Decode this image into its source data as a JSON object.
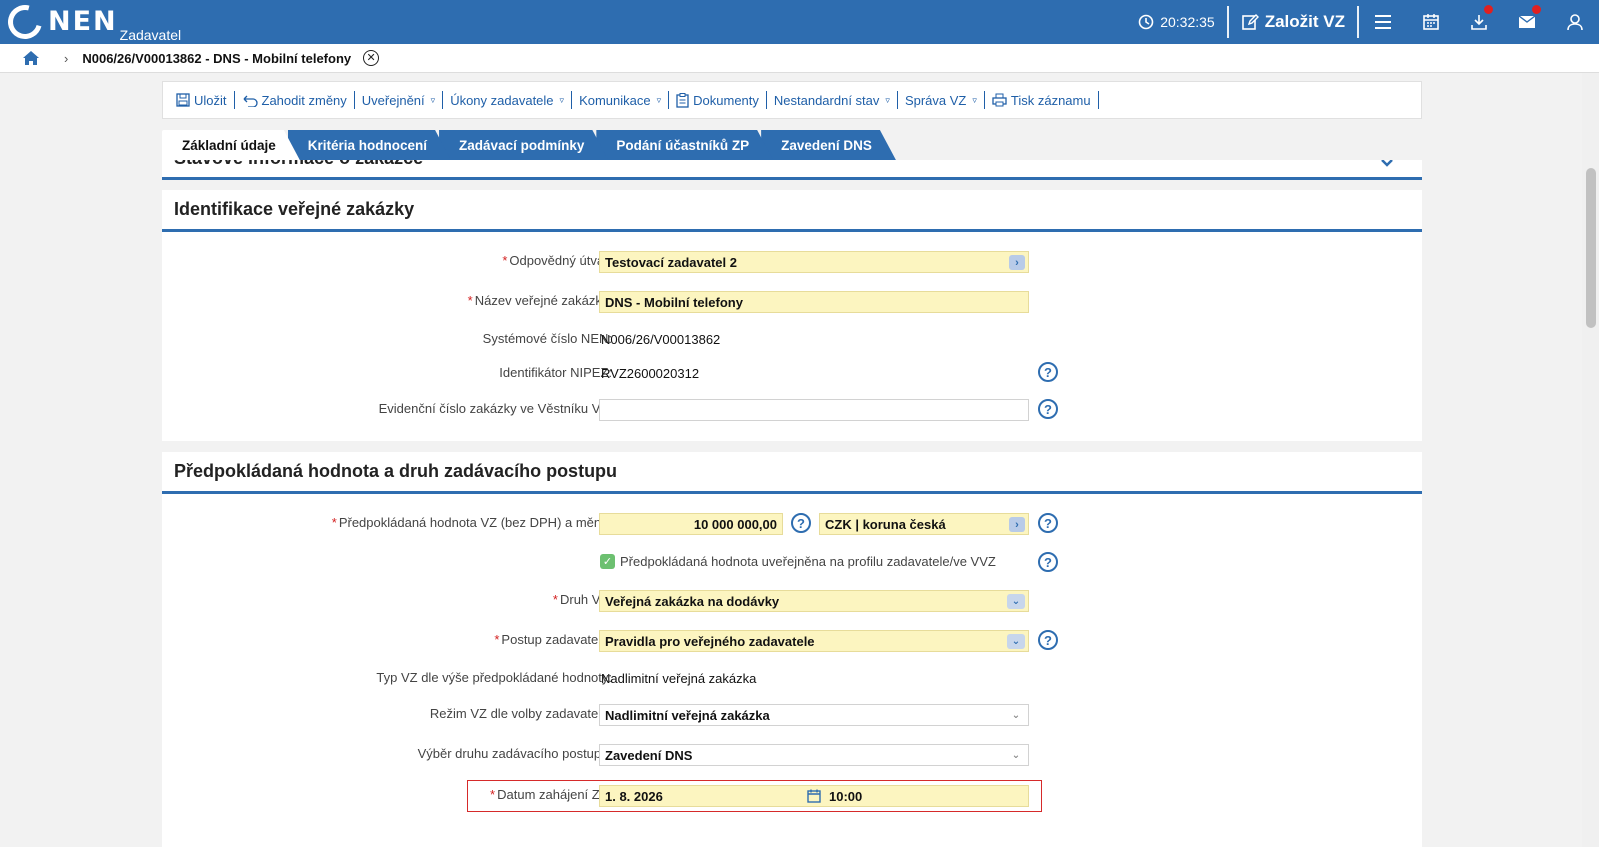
{
  "app": {
    "logo_text": "NEN",
    "logo_subtitle": "Zadavatel",
    "clock": "20:32:35",
    "create_button": "Založit VZ"
  },
  "breadcrumb": {
    "title": "N006/26/V00013862 - DNS - Mobilní telefony",
    "close_symbol": "✕"
  },
  "toolbar": {
    "items": [
      {
        "label": "Uložit"
      },
      {
        "label": "Zahodit změny"
      },
      {
        "label": "Uveřejnění"
      },
      {
        "label": "Úkony zadavatele"
      },
      {
        "label": "Komunikace"
      },
      {
        "label": "Dokumenty"
      },
      {
        "label": "Nestandardní stav"
      },
      {
        "label": "Správa VZ"
      },
      {
        "label": "Tisk záznamu"
      }
    ]
  },
  "tabs": [
    {
      "label": "Základní údaje",
      "active": true
    },
    {
      "label": "Kritéria hodnocení"
    },
    {
      "label": "Zadávací podmínky"
    },
    {
      "label": "Podání účastníků ZP"
    },
    {
      "label": "Zavedení DNS"
    }
  ],
  "partial_section": {
    "title": "Stavové informace o zakázce"
  },
  "identification": {
    "title": "Identifikace veřejné zakázky",
    "fields": {
      "unit_label": "Odpovědný útvar:",
      "unit_value": "Testovací zadavatel 2",
      "name_label": "Název veřejné zakázky:",
      "name_value": "DNS - Mobilní telefony",
      "sysnum_label": "Systémové číslo NEN:",
      "sysnum_value": "N006/26/V00013862",
      "nipez_label": "Identifikátor NIPEZ:",
      "nipez_value": "RVZ2600020312",
      "vestnik_label": "Evidenční číslo zakázky ve Věstníku VZ:",
      "vestnik_value": ""
    }
  },
  "value_section": {
    "title": "Předpokládaná hodnota a druh zadávacího postupu",
    "fields": {
      "value_label": "Předpokládaná hodnota VZ (bez DPH) a měna:",
      "value_amount": "10 000 000,00",
      "currency": "CZK | koruna česká",
      "published_label": "Předpokládaná hodnota uveřejněna na profilu zadavatele/ve VVZ",
      "type_label": "Druh VZ:",
      "type_value": "Veřejná zakázka na dodávky",
      "procedure_label": "Postup zadavatele:",
      "procedure_value": "Pravidla pro veřejného zadavatele",
      "category_label": "Typ VZ dle výše předpokládané hodnoty:",
      "category_value": "Nadlimitní veřejná zakázka",
      "regime_label": "Režim VZ dle volby zadavatele:",
      "regime_value": "Nadlimitní veřejná zakázka",
      "choice_label": "Výběr druhu zadávacího postupu:",
      "choice_value": "Zavedení DNS",
      "start_label": "Datum zahájení ZP:",
      "start_date": "1. 8. 2026",
      "start_time": "10:00"
    }
  },
  "colors": {
    "brand": "#2e6db0",
    "required_field": "#fcf5c0",
    "required_star": "#d32020",
    "highlight": "#d62a2a"
  }
}
